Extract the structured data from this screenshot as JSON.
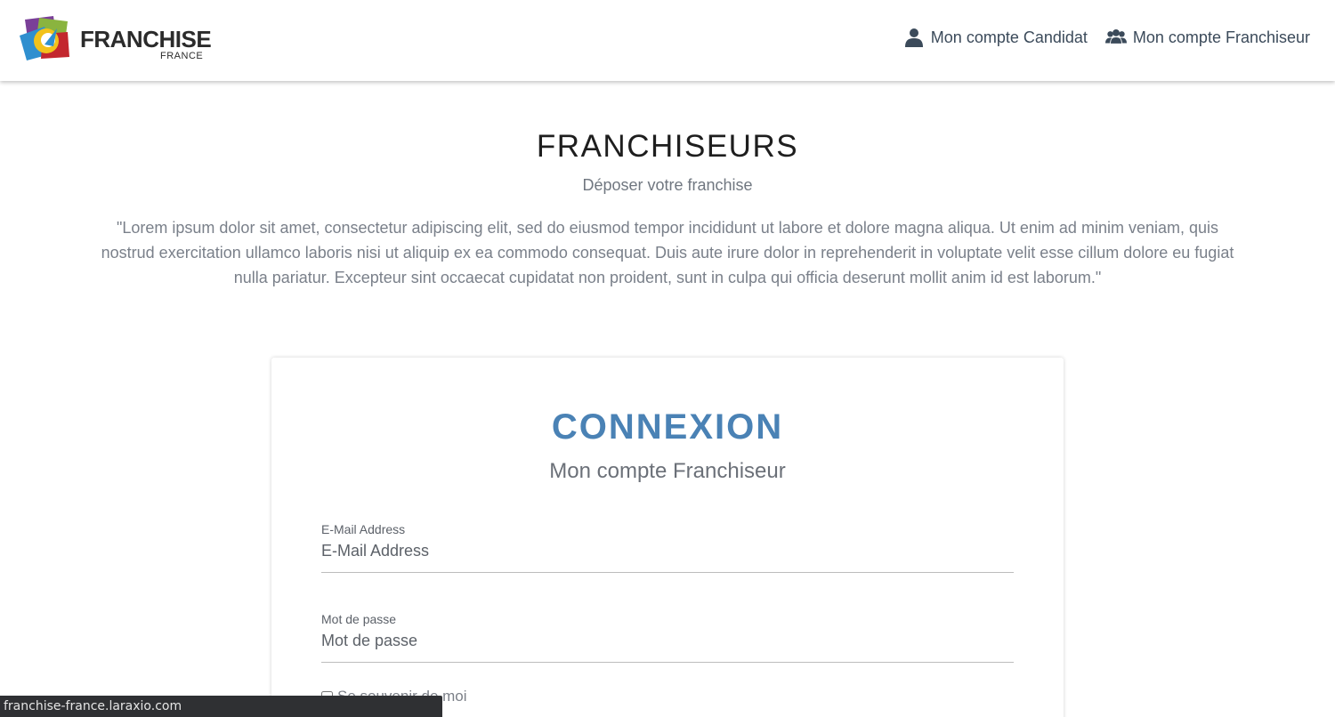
{
  "header": {
    "logo_word": "FRANCHISE",
    "logo_sub": "FRANCE",
    "nav": [
      {
        "label": "Mon compte Candidat",
        "icon": "user-icon"
      },
      {
        "label": "Mon compte Franchiseur",
        "icon": "users-icon"
      }
    ]
  },
  "hero": {
    "title": "FRANCHISEURS",
    "subtitle": "Déposer votre franchise",
    "text": "\"Lorem ipsum dolor sit amet, consectetur adipiscing elit, sed do eiusmod tempor incididunt ut labore et dolore magna aliqua. Ut enim ad minim veniam, quis nostrud exercitation ullamco laboris nisi ut aliquip ex ea commodo consequat. Duis aute irure dolor in reprehenderit in voluptate velit esse cillum dolore eu fugiat nulla pariatur. Excepteur sint occaecat cupidatat non proident, sunt in culpa qui officia deserunt mollit anim id est laborum.\""
  },
  "login": {
    "title": "CONNEXION",
    "subtitle": "Mon compte Franchiseur",
    "email_label": "E-Mail Address",
    "email_placeholder": "E-Mail Address",
    "email_value": "",
    "password_label": "Mot de passe",
    "password_placeholder": "Mot de passe",
    "password_value": "",
    "remember_label": "Se souvenir de moi",
    "remember_checked": false
  },
  "statusbar": {
    "url": "franchise-france.laraxio.com"
  },
  "colors": {
    "accent": "#4a82b5",
    "text": "#3b4a5a",
    "statusbar_bg": "#2f3033"
  }
}
